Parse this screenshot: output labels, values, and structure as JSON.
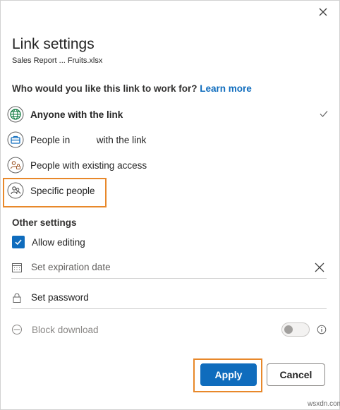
{
  "dialog": {
    "title": "Link settings",
    "file_name": "Sales Report ... Fruits.xlsx",
    "question": "Who would you like this link to work for?",
    "learn_more": "Learn more"
  },
  "options": [
    {
      "label": "Anyone with the link",
      "icon": "globe-icon",
      "selected": true
    },
    {
      "label": "People in          with the link",
      "icon": "briefcase-icon",
      "selected": false
    },
    {
      "label": "People with existing access",
      "icon": "people-lock-icon",
      "selected": false
    },
    {
      "label": "Specific people",
      "icon": "people-icon",
      "selected": false
    }
  ],
  "other_settings": {
    "heading": "Other settings",
    "allow_editing": {
      "label": "Allow editing",
      "checked": true
    },
    "expiration": {
      "placeholder": "Set expiration date"
    },
    "password": {
      "placeholder": "Set password"
    },
    "block_download": {
      "label": "Block download",
      "enabled": false
    }
  },
  "buttons": {
    "apply": "Apply",
    "cancel": "Cancel"
  },
  "watermark": "wsxdn.com",
  "colors": {
    "accent": "#0f6cbd",
    "highlight": "#e8882a",
    "globe_green": "#107c41",
    "briefcase_blue": "#0f6cbd",
    "access_brown": "#a05a2c"
  }
}
